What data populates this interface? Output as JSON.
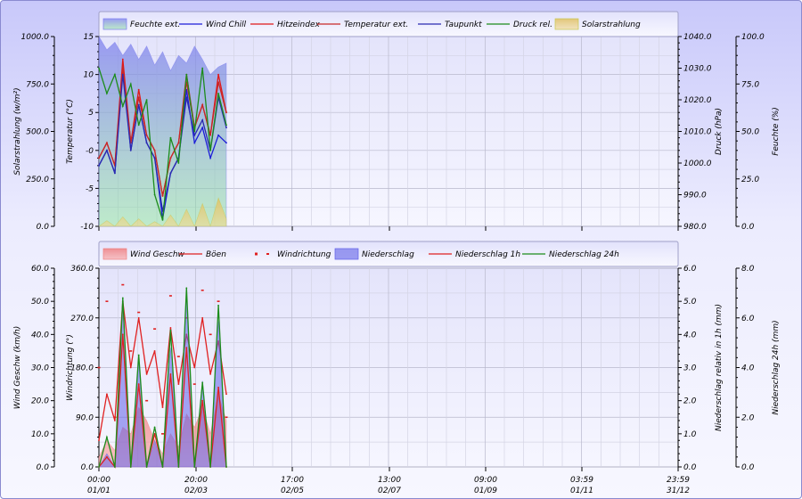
{
  "chart_data": [
    {
      "type": "area",
      "legend": [
        "Feuchte ext.",
        "Wind Chill",
        "Hitzeindex",
        "Temperatur ext.",
        "Taupunkt",
        "Druck rel.",
        "Solarstrahlung"
      ],
      "legend_placement": "top",
      "grid": true,
      "axes": {
        "solar": {
          "label": "Solarstrahlung (w/m²)",
          "ticks": [
            "0.0",
            "250.0",
            "500.0",
            "750.0",
            "1000.0"
          ],
          "range": [
            0,
            1000
          ]
        },
        "temp": {
          "label": "Temperatur (°C)",
          "ticks": [
            "-10",
            "-5",
            "-0",
            "5",
            "10",
            "15"
          ],
          "range": [
            -10,
            15
          ]
        },
        "pressure": {
          "label": "Druck (hPa)",
          "ticks": [
            "980.0",
            "990.0",
            "1000.0",
            "1010.0",
            "1020.0",
            "1030.0",
            "1040.0"
          ],
          "range": [
            980,
            1040
          ]
        },
        "humidity": {
          "label": "Feuchte (%)",
          "ticks": [
            "0.0",
            "25.0",
            "50.0",
            "75.0",
            "100.0"
          ],
          "range": [
            0,
            100
          ]
        }
      },
      "x": [
        0,
        4,
        8,
        12,
        16,
        20,
        24,
        28,
        32,
        36,
        40,
        44,
        48,
        52,
        56,
        60,
        64
      ],
      "series": [
        {
          "name": "Feuchte ext.",
          "axis": "humidity",
          "color": "#7c7cf0",
          "values": [
            100,
            93,
            97,
            90,
            96,
            88,
            95,
            85,
            92,
            82,
            90,
            86,
            95,
            88,
            80,
            84,
            86
          ]
        },
        {
          "name": "Wind Chill",
          "axis": "temp",
          "color": "#1c1cd8",
          "values": [
            -2,
            0,
            -3,
            11,
            0,
            6,
            1,
            -1,
            -9,
            -3,
            -1,
            8,
            1,
            3,
            -1,
            2,
            1
          ]
        },
        {
          "name": "Hitzeindex",
          "axis": "temp",
          "color": "#e01818",
          "values": [
            -1,
            1,
            -2,
            12,
            1,
            8,
            2,
            0,
            -6,
            -1,
            1,
            10,
            3,
            6,
            2,
            10,
            5
          ]
        },
        {
          "name": "Temperatur ext.",
          "axis": "temp",
          "color": "#c82828",
          "values": [
            -1,
            1,
            -2,
            11,
            1,
            7,
            2,
            0,
            -6,
            -1,
            1,
            9,
            3,
            6,
            2,
            9,
            5
          ]
        },
        {
          "name": "Taupunkt",
          "axis": "temp",
          "color": "#2a2ab0",
          "values": [
            -2,
            0,
            -3,
            10,
            0,
            6,
            1,
            -1,
            -8,
            -3,
            -1,
            7,
            2,
            4,
            0,
            7,
            3
          ]
        },
        {
          "name": "Druck rel.",
          "axis": "pressure",
          "color": "#1c8c1c",
          "values": [
            1030,
            1022,
            1028,
            1018,
            1025,
            1012,
            1020,
            990,
            982,
            1008,
            1000,
            1028,
            1010,
            1030,
            1004,
            1022,
            1012
          ]
        },
        {
          "name": "Solarstrahlung",
          "axis": "solar",
          "color": "#c8c850",
          "values": [
            0,
            30,
            0,
            50,
            0,
            40,
            0,
            25,
            0,
            60,
            0,
            90,
            0,
            120,
            0,
            150,
            40
          ]
        }
      ],
      "x_ticks": [
        {
          "time": "00:00",
          "date": "01/01"
        },
        {
          "time": "20:00",
          "date": "02/03"
        },
        {
          "time": "17:00",
          "date": "02/05"
        },
        {
          "time": "13:00",
          "date": "02/07"
        },
        {
          "time": "09:00",
          "date": "01/09"
        },
        {
          "time": "03:59",
          "date": "01/11"
        },
        {
          "time": "23:59",
          "date": "31/12"
        }
      ]
    },
    {
      "type": "area",
      "legend": [
        "Wind Geschw",
        "Böen",
        "Windrichtung",
        "Niederschlag",
        "Niederschlag 1h",
        "Niederschlag 24h"
      ],
      "legend_placement": "top",
      "grid": true,
      "axes": {
        "wind": {
          "label": "Wind Geschw (km/h)",
          "ticks": [
            "0.0",
            "10.0",
            "20.0",
            "30.0",
            "40.0",
            "50.0",
            "60.0"
          ],
          "range": [
            0,
            60
          ]
        },
        "dir": {
          "label": "Windrichtung (°)",
          "ticks": [
            "0.0",
            "90.0",
            "180.0",
            "270.0",
            "360.0"
          ],
          "range": [
            0,
            360
          ]
        },
        "rain1h": {
          "label": "Niederschlag relativ in 1h (mm)",
          "ticks": [
            "0.0",
            "1.0",
            "2.0",
            "3.0",
            "4.0",
            "5.0",
            "6.0"
          ],
          "range": [
            0,
            6
          ]
        },
        "rain24h": {
          "label": "Niederschlag 24h (mm)",
          "ticks": [
            "0.0",
            "2.0",
            "4.0",
            "6.0",
            "8.0"
          ],
          "range": [
            0,
            8
          ]
        }
      },
      "x": [
        0,
        4,
        8,
        12,
        16,
        20,
        24,
        28,
        32,
        36,
        40,
        44,
        48,
        52,
        56,
        60,
        64
      ],
      "series": [
        {
          "name": "Wind Geschw",
          "axis": "wind",
          "color": "#f08080",
          "values": [
            3,
            8,
            5,
            12,
            10,
            18,
            14,
            8,
            4,
            10,
            6,
            16,
            12,
            18,
            10,
            22,
            14
          ]
        },
        {
          "name": "Böen",
          "axis": "wind",
          "color": "#e02020",
          "values": [
            8,
            22,
            14,
            50,
            30,
            45,
            28,
            35,
            18,
            42,
            25,
            40,
            30,
            45,
            28,
            38,
            22
          ]
        },
        {
          "name": "Windrichtung",
          "axis": "dir",
          "color": "#e02020",
          "values": [
            180,
            300,
            90,
            330,
            210,
            280,
            120,
            250,
            60,
            310,
            200,
            270,
            150,
            320,
            240,
            300,
            90
          ]
        },
        {
          "name": "Niederschlag",
          "axis": "rain1h",
          "color": "#6060e8",
          "values": [
            0,
            0.4,
            0,
            5.0,
            0,
            3.2,
            0,
            0.8,
            0,
            3.6,
            0,
            5.2,
            0,
            2.6,
            0,
            4.4,
            0
          ]
        },
        {
          "name": "Niederschlag 1h",
          "axis": "rain1h",
          "color": "#e02020",
          "values": [
            0,
            0.3,
            0,
            4.0,
            0,
            2.5,
            0,
            1.0,
            0,
            2.8,
            0,
            3.6,
            0,
            2.0,
            0,
            2.4,
            0
          ]
        },
        {
          "name": "Niederschlag 24h",
          "axis": "rain24h",
          "color": "#1c8c1c",
          "values": [
            0,
            1.2,
            0,
            6.8,
            0,
            4.5,
            0,
            1.6,
            0,
            5.5,
            0,
            7.2,
            0,
            3.4,
            0,
            6.5,
            0
          ]
        }
      ],
      "x_ticks": [
        {
          "time": "00:00",
          "date": "01/01"
        },
        {
          "time": "20:00",
          "date": "02/03"
        },
        {
          "time": "17:00",
          "date": "02/05"
        },
        {
          "time": "13:00",
          "date": "02/07"
        },
        {
          "time": "09:00",
          "date": "01/09"
        },
        {
          "time": "03:59",
          "date": "01/11"
        },
        {
          "time": "23:59",
          "date": "31/12"
        }
      ]
    }
  ]
}
